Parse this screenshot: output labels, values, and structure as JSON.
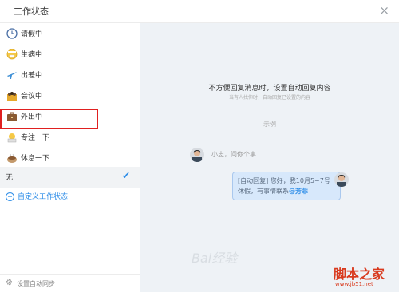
{
  "dialog": {
    "title": "工作状态",
    "close_icon": "×"
  },
  "statuses": [
    {
      "label": "请假中",
      "icon": "clock-icon"
    },
    {
      "label": "生病中",
      "icon": "sick-face-icon"
    },
    {
      "label": "出差中",
      "icon": "airplane-icon"
    },
    {
      "label": "会议中",
      "icon": "meeting-icon"
    },
    {
      "label": "外出中",
      "icon": "briefcase-icon"
    },
    {
      "label": "专注一下",
      "icon": "focus-icon"
    },
    {
      "label": "休息一下",
      "icon": "coffee-icon"
    }
  ],
  "none_option": {
    "label": "无",
    "selected": true
  },
  "custom_link": "自定义工作状态",
  "footer": {
    "label": "设置自动同步"
  },
  "preview": {
    "heading": "不方便回复消息时，设置自动回复内容",
    "subheading": "当有人找你时，自动回复已设置的内容",
    "example_label": "示例",
    "incoming_message": "小志，问你个事",
    "reply_line1": "[自动回复] 您好，我10月5~7号",
    "reply_line2": "休假，有事情联系",
    "reply_mention": "@芳菲"
  },
  "watermarks": {
    "baidu": "Bai经验",
    "site": "脚本之家",
    "site_url": "www.jb51.net"
  },
  "colors": {
    "accent": "#2f8ee8",
    "highlight": "#e02020",
    "preview_bg": "#eef2f6"
  }
}
